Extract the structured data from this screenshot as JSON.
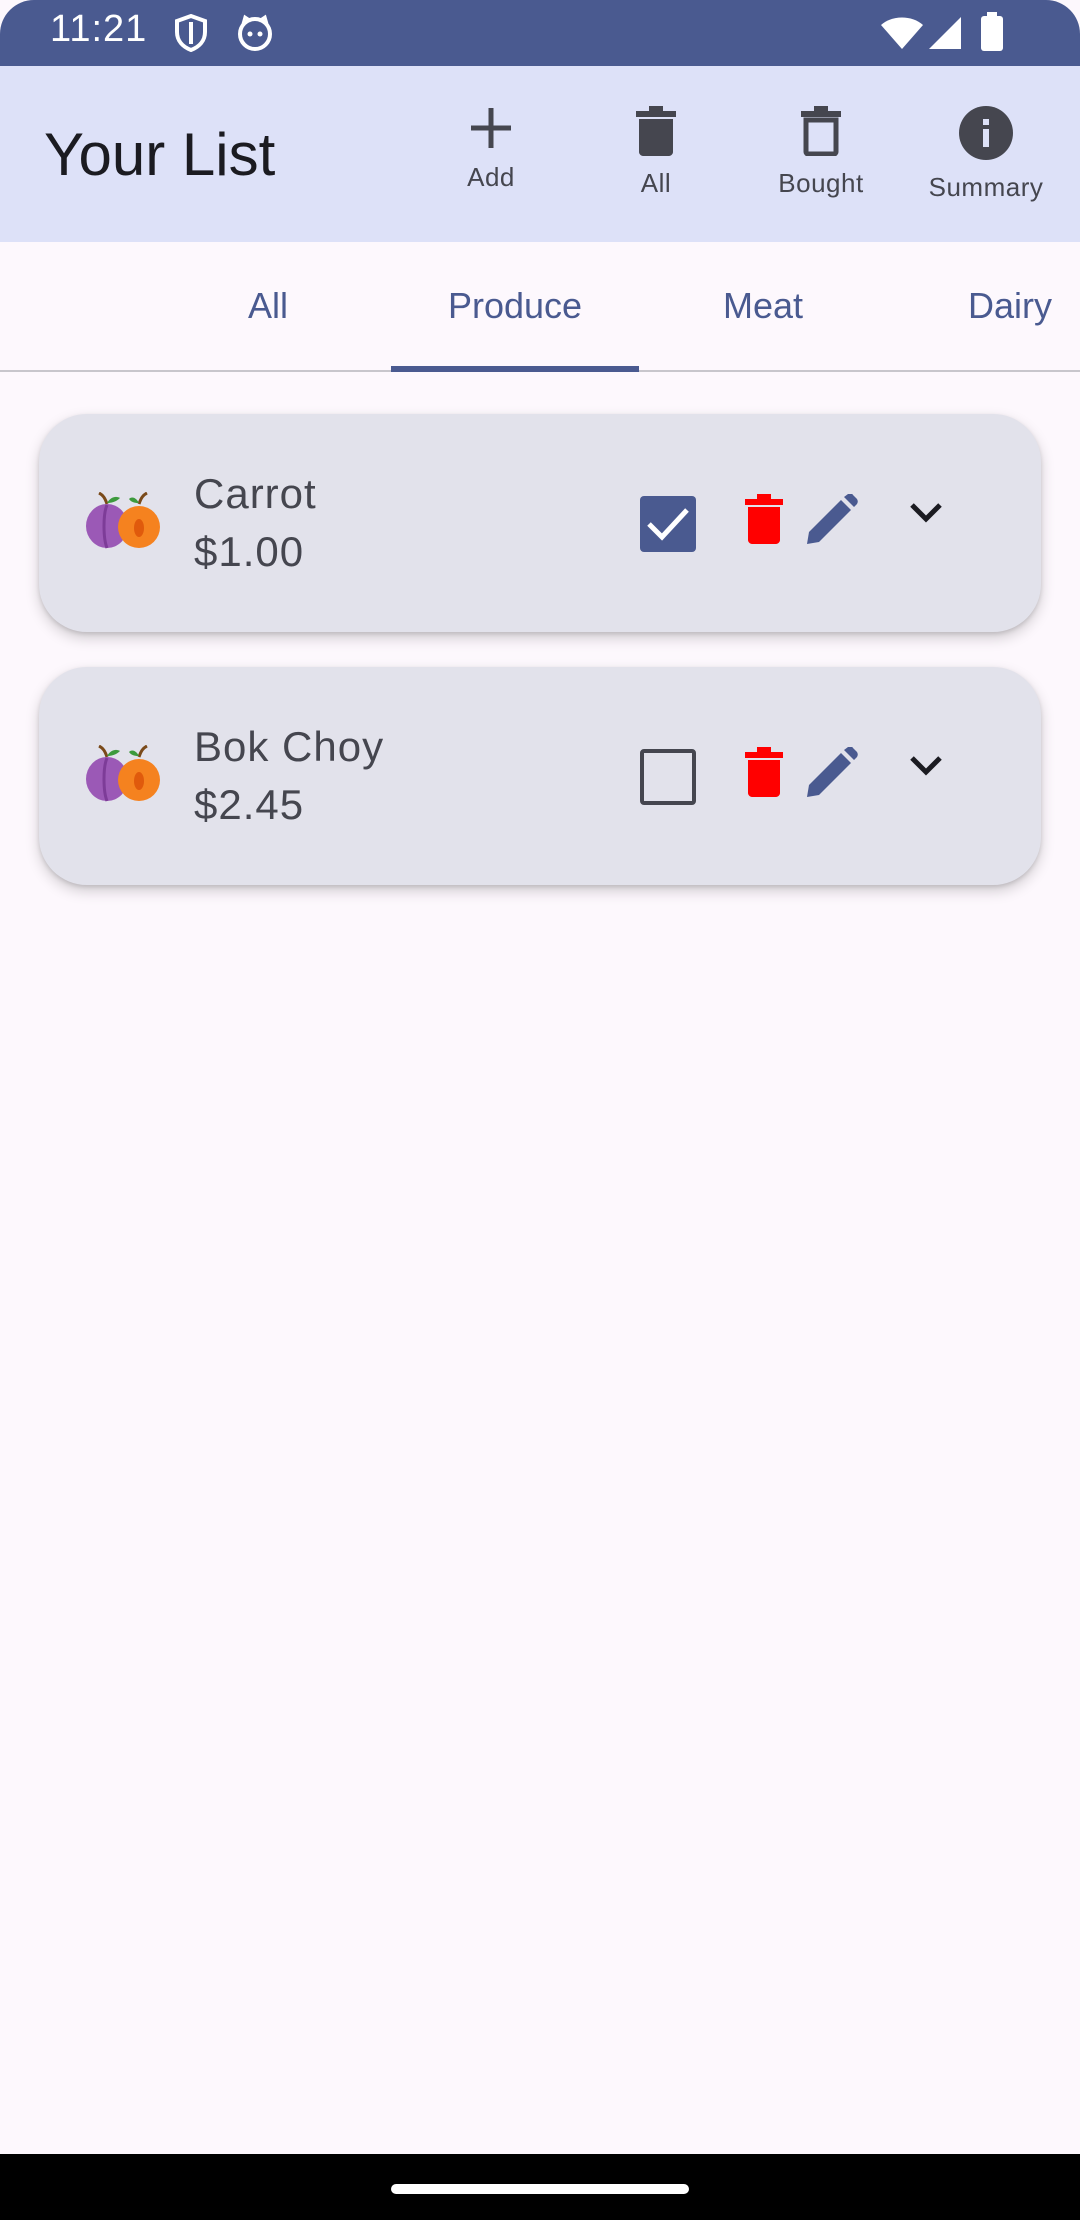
{
  "status_bar": {
    "time": "11:21",
    "icons": [
      "shield-icon",
      "cat-face-icon",
      "wifi-icon",
      "cell-signal-icon",
      "battery-icon"
    ]
  },
  "app_bar": {
    "title": "Your List",
    "actions": [
      {
        "label": "Add",
        "icon": "plus-icon"
      },
      {
        "label": "All",
        "icon": "trash-filled-icon"
      },
      {
        "label": "Bought",
        "icon": "trash-outline-icon"
      },
      {
        "label": "Summary",
        "icon": "info-icon"
      }
    ]
  },
  "tabs": {
    "items": [
      "All",
      "Produce",
      "Meat",
      "Dairy"
    ],
    "selected": "Produce"
  },
  "items": [
    {
      "name": "Carrot",
      "price": "$1.00",
      "bought": true,
      "icon": "fruit-emoji-icon"
    },
    {
      "name": "Bok Choy",
      "price": "$2.45",
      "bought": false,
      "icon": "fruit-emoji-icon"
    }
  ],
  "colors": {
    "primary": "#4a5a90",
    "app_bar_bg": "#dde1f8",
    "card_bg": "#e2e2eb",
    "delete_red": "#ff0000",
    "background": "#fdf8fd"
  }
}
